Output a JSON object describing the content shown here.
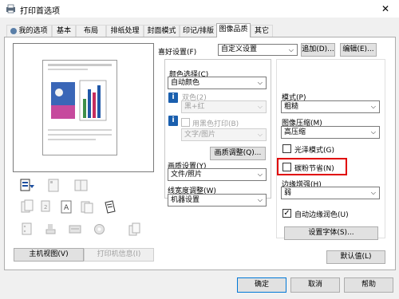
{
  "window": {
    "title": "打印首选项",
    "close_glyph": "✕"
  },
  "tabs": [
    {
      "label": "我的选项"
    },
    {
      "label": "基本"
    },
    {
      "label": "布局"
    },
    {
      "label": "排纸处理"
    },
    {
      "label": "封面模式"
    },
    {
      "label": "印记/排版"
    },
    {
      "label": "图像品质"
    },
    {
      "label": "其它"
    }
  ],
  "active_tab": "图像品质",
  "favorites": {
    "label": "喜好设置(F)",
    "value": "自定义设置",
    "add_button": "追加(D)...",
    "edit_button": "编辑(E)..."
  },
  "preview": {
    "main_view_button": "主机视图(V)",
    "printer_info_button": "打印机信息(I)"
  },
  "color": {
    "label": "颜色选择(C)",
    "value": "自动颜色",
    "dual_color_label": "双色(2)",
    "dual_color_value": "黑+红",
    "black_print_label": "用黑色打印(B)",
    "black_print_value": "文字/图片",
    "quality_adjust_button": "画质调整(Q)..."
  },
  "image_quality": {
    "label": "画质设置(Y)",
    "value": "文件/照片"
  },
  "line_width": {
    "label": "线宽度调整(W)",
    "value": "机器设置"
  },
  "mode": {
    "label": "模式(P)",
    "value": "粗糙"
  },
  "compression": {
    "label": "图像压缩(M)",
    "value": "高压缩"
  },
  "gloss_mode": {
    "label": "光泽模式(G)",
    "checked": false
  },
  "toner_save": {
    "label": "碳粉节省(N)",
    "checked": false
  },
  "edge_enhance": {
    "label": "边缘增强(H)",
    "value": "弱"
  },
  "auto_trapping": {
    "label": "自动边缘润色(U)",
    "checked": true,
    "mark": "✓"
  },
  "set_fonts_button": "设置字体(S)...",
  "default_button": "默认值(L)",
  "footer": {
    "ok": "确定",
    "cancel": "取消",
    "help": "帮助"
  },
  "colors": {
    "highlight": "#e00000",
    "info_icon": "#1a5fae",
    "tab_active_bg": "#ffffff"
  },
  "icons": {
    "app": "printer-settings-icon",
    "info": "info-icon",
    "dropdown": "chevron-down-icon"
  },
  "glyphs": {
    "info": "i",
    "chevron": "⌵"
  }
}
